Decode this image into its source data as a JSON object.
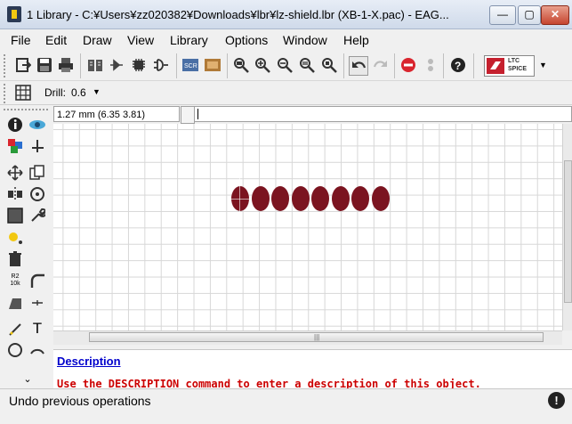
{
  "window": {
    "title": "1 Library - C:¥Users¥zz020382¥Downloads¥lbr¥lz-shield.lbr (XB-1-X.pac) - EAG...",
    "min_glyph": "—",
    "max_glyph": "▢",
    "close_glyph": "✕"
  },
  "menu": [
    "File",
    "Edit",
    "Draw",
    "View",
    "Library",
    "Options",
    "Window",
    "Help"
  ],
  "toolbar": {
    "ltspice_line1": "LTC",
    "ltspice_line2": "SPICE"
  },
  "param_bar": {
    "drill_label": "Drill:",
    "drill_value": "0.6"
  },
  "coord_display": "1.27 mm (6.35 3.81)",
  "command_line": "",
  "palette": {
    "resistor_top": "R2",
    "resistor_bottom": "10k",
    "text_glyph": "T"
  },
  "pads": {
    "count": 8,
    "color": "#7b1420"
  },
  "description": {
    "title": "Description",
    "text": "Use the DESCRIPTION command to enter a description of this object."
  },
  "status": {
    "text": "Undo previous operations",
    "icon": "!"
  },
  "colors": {
    "pad": "#7b1420",
    "stop": "#d9252e",
    "link": "#0000cc",
    "desc_text": "#cc0000"
  }
}
